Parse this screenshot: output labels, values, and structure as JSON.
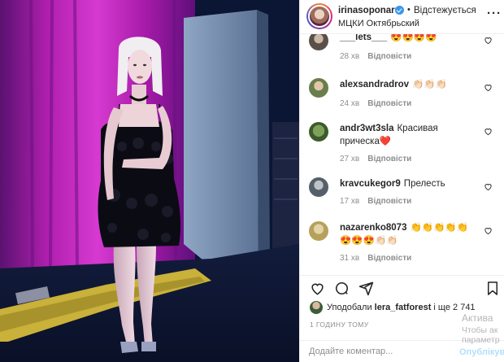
{
  "post": {
    "username": "irinasoponaru",
    "separator": "•",
    "follow_status": "Відстежується",
    "location": "МЦКИ Октябрьский",
    "more_icon": "more-dots-icon"
  },
  "comments": [
    {
      "user": "___lets___",
      "text": "😍😍😍😍",
      "time": "28 хв",
      "reply": "Відповісти"
    },
    {
      "user": "alexsandradrov",
      "text": "👏🏻👏🏻👏🏻",
      "time": "24 хв",
      "reply": "Відповісти"
    },
    {
      "user": "andr3wt3sla",
      "text": "Красивая прическа❤️",
      "time": "27 хв",
      "reply": "Відповісти"
    },
    {
      "user": "kravcukegor9",
      "text": "Прелесть",
      "time": "17 хв",
      "reply": "Відповісти"
    },
    {
      "user": "nazarenko8073",
      "text": "👏👏👏👏👏😍😍😍👏🏻👏🏻",
      "time": "31 хв",
      "reply": "Відповісти"
    }
  ],
  "likes": {
    "prefix": "Уподобали",
    "user": "lera_fatforest",
    "suffix": "і ще 2 741"
  },
  "time_ago": "1 ГОДИНУ ТОМУ",
  "add_comment": {
    "placeholder": "Додайте коментар...",
    "publish": "Опублікувати"
  },
  "watermark": {
    "line1": "Актива",
    "line2": "Чтобы ак",
    "line3": "параметр"
  },
  "colors": {
    "link_blue": "#3897f0",
    "muted": "#8e8e8e",
    "text": "#262626",
    "publish_disabled": "#b2dffc"
  }
}
